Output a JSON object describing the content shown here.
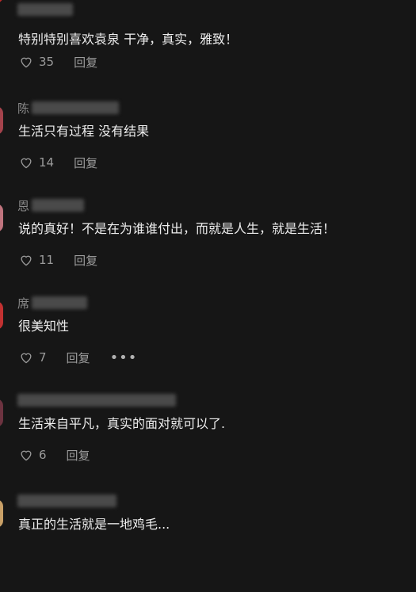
{
  "comments": [
    {
      "name_char": "",
      "text": "特别特别喜欢袁泉 干净，真实，雅致！",
      "likes": "35",
      "reply": "回复",
      "avatar_color": "#b82a2a"
    },
    {
      "name_char": "陈",
      "text": "生活只有过程 没有结果",
      "likes": "14",
      "reply": "回复",
      "avatar_color": "#a5434c"
    },
    {
      "name_char": "恩",
      "text": "说的真好！不是在为谁谁付出，而就是人生，就是生活！",
      "likes": "11",
      "reply": "回复",
      "avatar_color": "#c0747e"
    },
    {
      "name_char": "席",
      "text": "很美知性",
      "likes": "7",
      "reply": "回复",
      "more": "•••",
      "avatar_color": "#c23131"
    },
    {
      "name_char": "",
      "text": "生活来自平凡，真实的面对就可以了.",
      "likes": "6",
      "reply": "回复",
      "avatar_color": "#6d3340"
    },
    {
      "name_char": "",
      "text": "真正的生活就是一地鸡毛...",
      "likes": "",
      "reply": "",
      "avatar_color": "#c9a067"
    }
  ]
}
